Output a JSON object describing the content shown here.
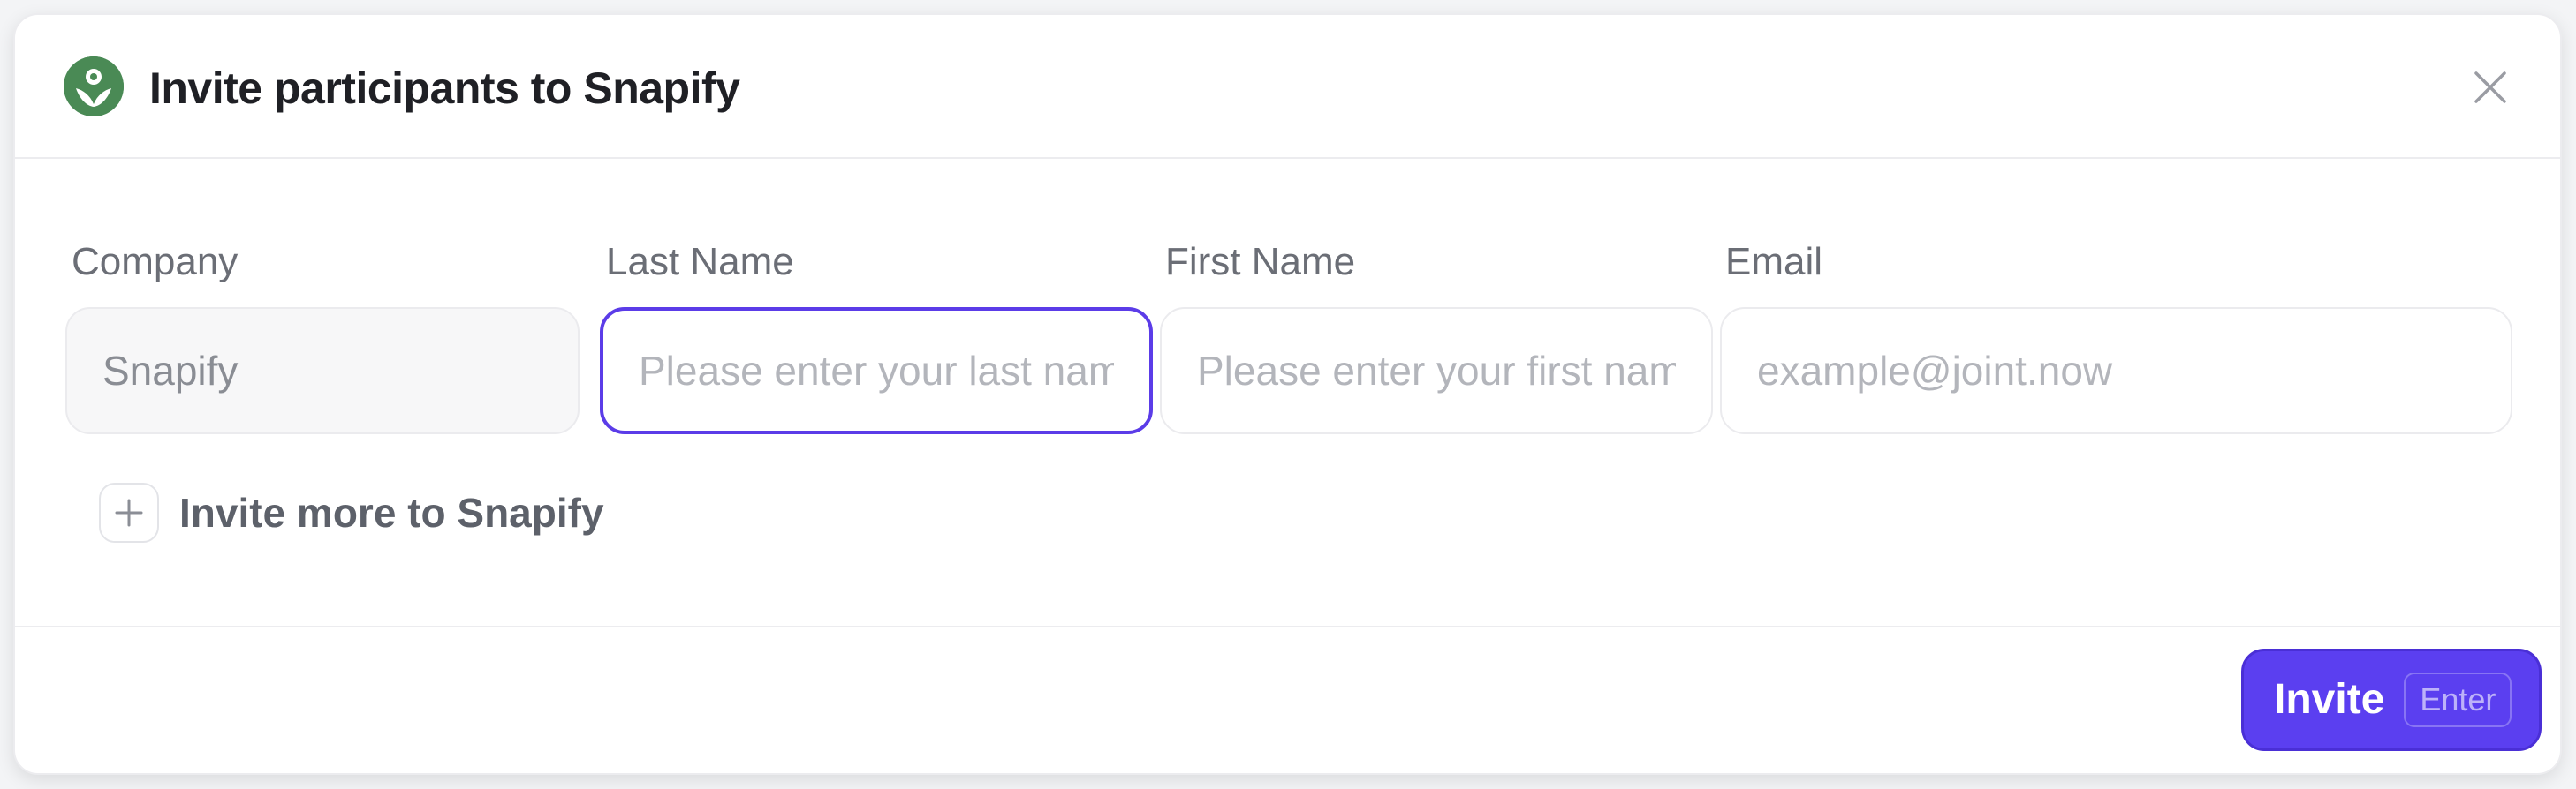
{
  "dialog": {
    "title": "Invite participants to Snapify",
    "logo_icon": "leaf-person-icon",
    "close_icon": "close-icon"
  },
  "form": {
    "company": {
      "label": "Company",
      "value": "Snapify"
    },
    "last_name": {
      "label": "Last Name",
      "value": "",
      "placeholder": "Please enter your last name"
    },
    "first_name": {
      "label": "First Name",
      "value": "",
      "placeholder": "Please enter your first name"
    },
    "email": {
      "label": "Email",
      "value": "",
      "placeholder": "example@joint.now"
    }
  },
  "invite_more": {
    "label": "Invite more to Snapify",
    "icon": "plus-icon"
  },
  "footer": {
    "invite_label": "Invite",
    "shortcut": "Enter"
  },
  "colors": {
    "accent": "#5b3ff0",
    "focus_border": "#5b3ce8",
    "logo_green": "#4a8a55"
  }
}
